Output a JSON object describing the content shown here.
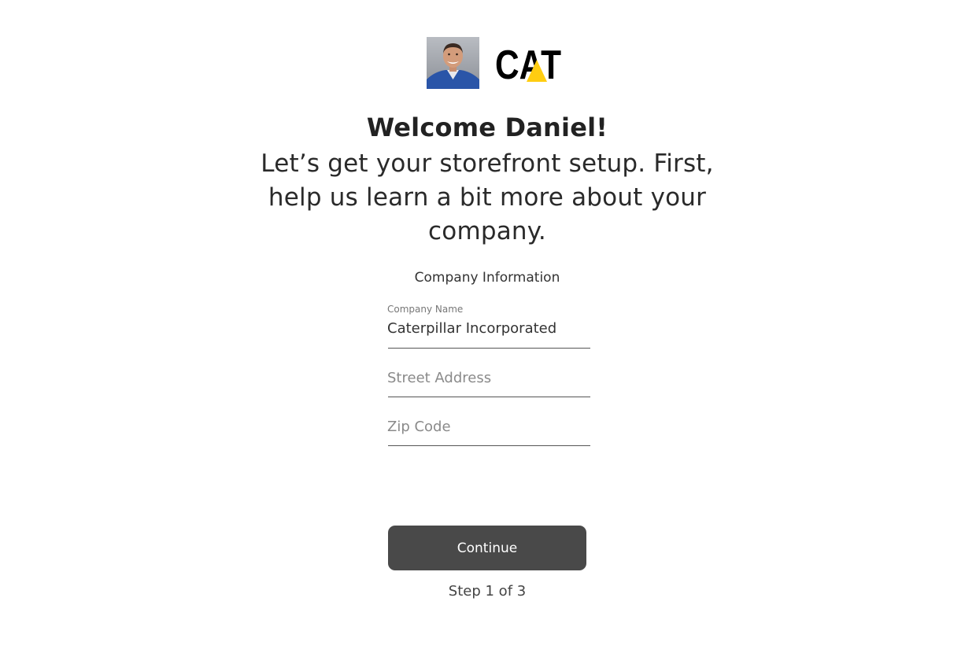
{
  "header": {
    "avatar_icon": "user-avatar-photo",
    "brand_logo_text": "CAT",
    "brand_colors": {
      "text": "#000000",
      "triangle": "#ffcd11"
    }
  },
  "welcome": {
    "title": "Welcome Daniel!",
    "subtitle": "Let’s get your storefront setup. First, help us learn a bit more about your company."
  },
  "form": {
    "section_title": "Company Information",
    "company_name": {
      "label": "Company Name",
      "value": "Caterpillar Incorporated"
    },
    "street_address": {
      "placeholder": "Street Address",
      "value": ""
    },
    "zip_code": {
      "placeholder": "Zip Code",
      "value": ""
    }
  },
  "actions": {
    "continue_label": "Continue",
    "button_color": "#494949"
  },
  "progress": {
    "step_text": "Step 1 of 3",
    "current": 1,
    "total": 3
  }
}
